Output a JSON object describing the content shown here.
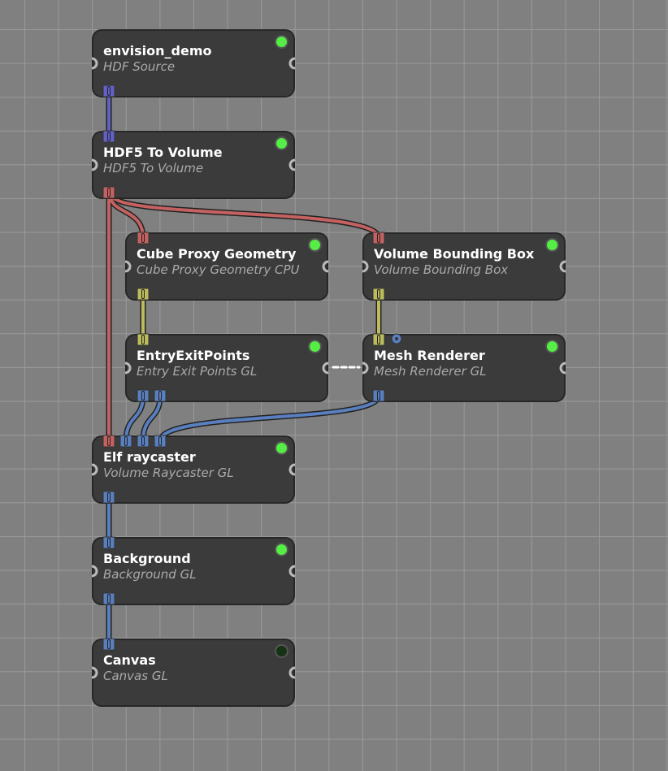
{
  "nodes": [
    {
      "title": "envision_demo",
      "subtitle": "HDF Source",
      "status": "active"
    },
    {
      "title": "HDF5 To Volume",
      "subtitle": "HDF5 To Volume",
      "status": "active"
    },
    {
      "title": "Cube Proxy Geometry",
      "subtitle": "Cube Proxy Geometry CPU",
      "status": "active"
    },
    {
      "title": "Volume Bounding Box",
      "subtitle": "Volume Bounding Box",
      "status": "active"
    },
    {
      "title": "EntryExitPoints",
      "subtitle": "Entry Exit Points GL",
      "status": "active"
    },
    {
      "title": "Mesh Renderer",
      "subtitle": "Mesh Renderer GL",
      "status": "active"
    },
    {
      "title": "Elf raycaster",
      "subtitle": "Volume Raycaster GL",
      "status": "active"
    },
    {
      "title": "Background",
      "subtitle": "Background GL",
      "status": "active"
    },
    {
      "title": "Canvas",
      "subtitle": "Canvas GL",
      "status": "inactive"
    }
  ],
  "colors": {
    "hdf_port": "#6262c4",
    "volume_port": "#c46262",
    "mesh_port": "#bcbc5e",
    "image_port": "#5a7fbf",
    "status_active": "#55ee44",
    "status_inactive": "#143214"
  }
}
